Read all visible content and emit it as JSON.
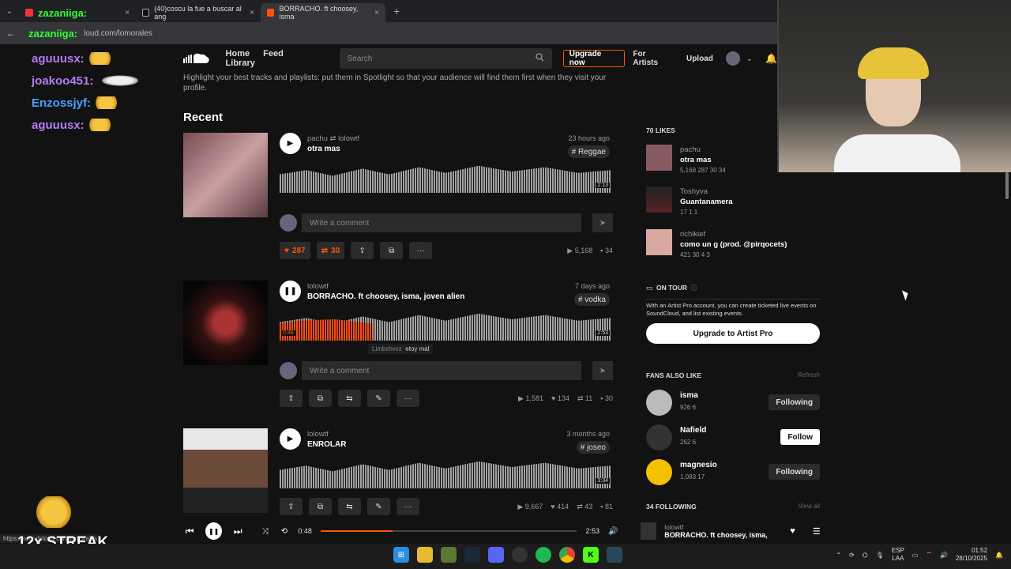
{
  "browser": {
    "tabs": [
      {
        "label": "zazaniiga:",
        "active": false
      },
      {
        "label": "(40)coscu la fue a buscar al ang",
        "active": false
      },
      {
        "label": "BORRACHO. ft choosey, isma",
        "active": true
      }
    ],
    "url_overlay": "zazaniiga:",
    "url_text": "loud.com/lomorales",
    "status_url": "https://soundcloud.com/lomorales"
  },
  "stream_overlay": {
    "chat": [
      {
        "user": "aguuusx:"
      },
      {
        "user": "joakoo451:"
      },
      {
        "user": "Enzossjyf:"
      },
      {
        "user": "aguuusx:"
      }
    ],
    "streak": "12x STREAK"
  },
  "header": {
    "nav": [
      "Home",
      "Feed",
      "Library"
    ],
    "search_placeholder": "Search",
    "upgrade": "Upgrade now",
    "for_artists": "For Artists",
    "upload": "Upload"
  },
  "main": {
    "spotlight_text": "Highlight your best tracks and playlists: put them in Spotlight so that your audience will find them first when they visit your profile.",
    "recent_heading": "Recent",
    "comment_placeholder": "Write a comment",
    "tracks": [
      {
        "artist": "pachu",
        "reposted_by": "lolowtf",
        "title": "otra mas",
        "date": "23 hours ago",
        "tag": "# Reggae",
        "duration": "2:13",
        "likes": "287",
        "reposts": "30",
        "plays": "5,168",
        "comments": "34"
      },
      {
        "artist": "lolowtf",
        "title": "BORRACHO. ft choosey, isma, joven alien",
        "date": "7 days ago",
        "tag": "# vodka",
        "current": "0:48",
        "duration": "2:53",
        "progress": 0.28,
        "tooltip_user": "Limbxhvvz",
        "tooltip_text": "etoy mal",
        "plays": "1,581",
        "likes": "134",
        "reposts": "11",
        "comments": "30"
      },
      {
        "artist": "lolowtf",
        "title": "ENROLAR",
        "date": "3 months ago",
        "tag": "# joseo",
        "duration": "3:34",
        "plays": "9,667",
        "likes": "414",
        "reposts": "43",
        "comments": "81"
      }
    ]
  },
  "sidebar": {
    "likes_heading": "70 LIKES",
    "likes": [
      {
        "artist": "pachu",
        "title": "otra mas",
        "stats": "5,168   287   30   34"
      },
      {
        "artist": "Toshyva",
        "title": "Guantanamera",
        "stats": "17   1   1"
      },
      {
        "artist": "richikief",
        "title": "como un g (prod. @pirqocets)",
        "stats": "421   30   4   3"
      }
    ],
    "on_tour_heading": "ON TOUR",
    "on_tour_text": "With an Artist Pro account, you can create ticketed live events on SoundCloud, and list existing events.",
    "artist_pro_button": "Upgrade to Artist Pro",
    "fans_heading": "FANS ALSO LIKE",
    "refresh": "Refresh",
    "fans": [
      {
        "name": "isma",
        "stats": "926   6",
        "button": "Following"
      },
      {
        "name": "Nafield",
        "stats": "262   6",
        "button": "Follow"
      },
      {
        "name": "magnesio",
        "stats": "1,083   17",
        "button": "Following"
      }
    ],
    "following_heading": "34 FOLLOWING",
    "view_all": "View all"
  },
  "player": {
    "current": "0:48",
    "total": "2:53",
    "progress": 0.28,
    "artist": "lolowtf",
    "title": "BORRACHO. ft choosey, isma,..."
  },
  "tray": {
    "lang": "ESP",
    "lang2": "LAA",
    "time": "01:52",
    "date": "28/10/2025"
  }
}
